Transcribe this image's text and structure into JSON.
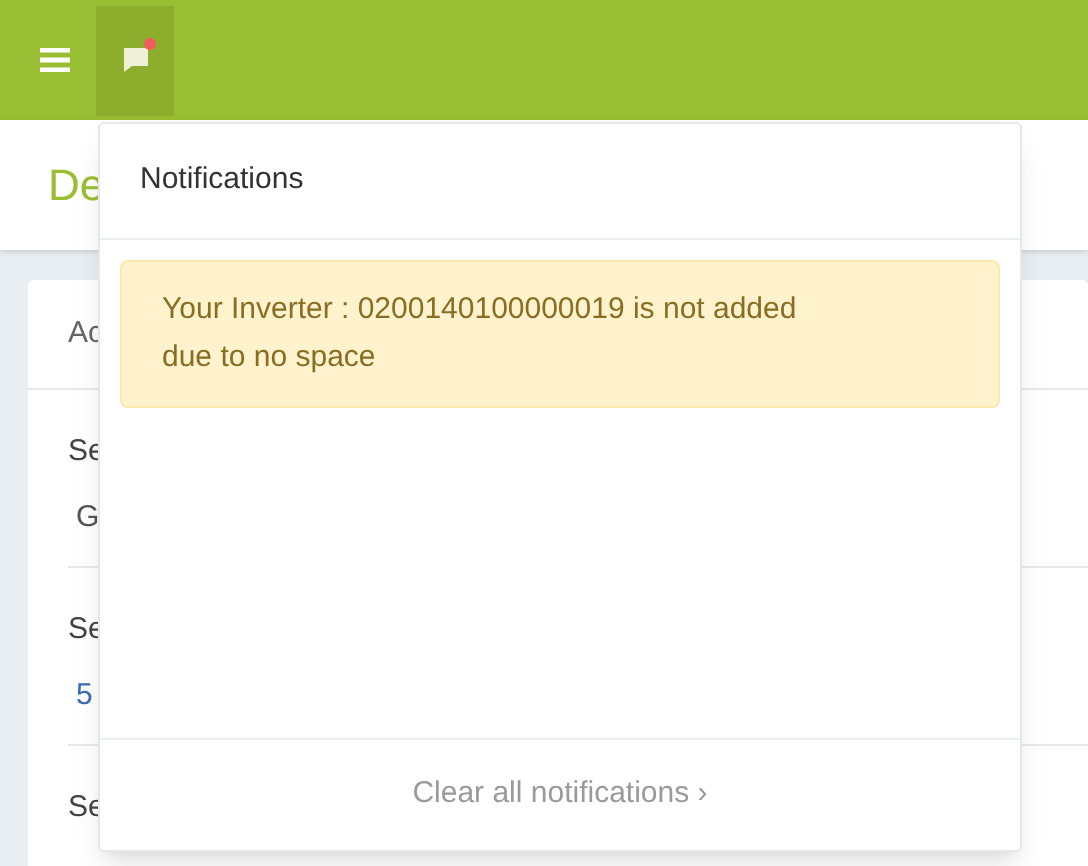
{
  "header": {
    "notifications_open": true,
    "has_unread": true
  },
  "page_title": "De",
  "card": {
    "tab": "Ac",
    "fields": [
      {
        "label": "Se",
        "value": "G",
        "kind": "text"
      },
      {
        "label": "Se",
        "value": "5",
        "kind": "link"
      },
      {
        "label": "Se"
      }
    ]
  },
  "notifications": {
    "title": "Notifications",
    "items": [
      {
        "text": "Your Inverter : 0200140100000019 is not added due to no space",
        "kind": "warning"
      }
    ],
    "footer": "Clear all notifications",
    "footer_arrow": "›"
  }
}
